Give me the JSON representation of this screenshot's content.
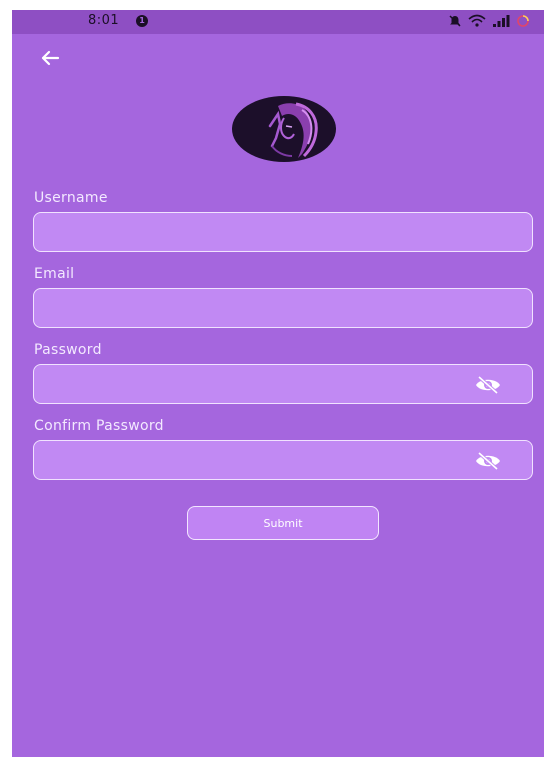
{
  "status_bar": {
    "time": "8:01",
    "notification_count": "1",
    "icons": [
      "mute-icon",
      "wifi-icon",
      "signal-icon",
      "battery-icon"
    ]
  },
  "navigation": {
    "back_icon": "arrow-left-icon"
  },
  "form": {
    "fields": [
      {
        "label": "Username",
        "value": "",
        "placeholder": ""
      },
      {
        "label": "Email",
        "value": "",
        "placeholder": ""
      },
      {
        "label": "Password",
        "value": "",
        "placeholder": "",
        "toggle_icon": "eye-off-icon"
      },
      {
        "label": "Confirm Password",
        "value": "",
        "placeholder": "",
        "toggle_icon": "eye-off-icon"
      }
    ],
    "submit_label": "Submit"
  },
  "colors": {
    "background": "#a566de",
    "status_bar": "#8e4fc3",
    "input_fill": "#c189f3",
    "input_border": "#f1e2ff",
    "avatar_bg": "#1c0f2a"
  }
}
